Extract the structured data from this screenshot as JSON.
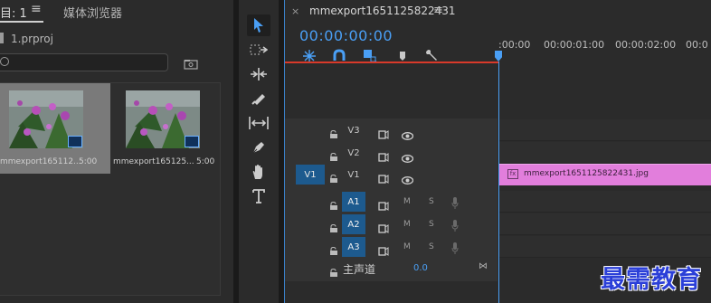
{
  "project_panel": {
    "tab_label": "目: 1",
    "tab_menu": "≡",
    "media_tab_label": "媒体浏览器",
    "path": "1.prproj",
    "clips": [
      {
        "name": "mmexport165112...",
        "duration": "5:00"
      },
      {
        "name": "mmexport165125...",
        "duration": "5:00"
      }
    ]
  },
  "timeline": {
    "close": "×",
    "title": "mmexport1651125822431",
    "menu": "≡",
    "timecode": "00:00:00:00",
    "ruler_labels": [
      ":00:00",
      "00:00:01:00",
      "00:00:02:00",
      "00:0"
    ],
    "video_tracks": [
      {
        "name": "V3"
      },
      {
        "name": "V2"
      },
      {
        "name": "V1",
        "target": "V1"
      }
    ],
    "audio_tracks": [
      {
        "name": "A1",
        "m": "M",
        "s": "S"
      },
      {
        "name": "A2",
        "m": "M",
        "s": "S"
      },
      {
        "name": "A3",
        "m": "M",
        "s": "S"
      }
    ],
    "master": {
      "label": "主声道",
      "value": "0.0",
      "end_icon": "⋈"
    },
    "clip": {
      "fx": "fx",
      "label": "mmexport1651125822431.jpg"
    }
  },
  "watermark": "最需教育",
  "colors": {
    "accent": "#4a9ff5",
    "clip": "#e27edc",
    "target": "#1d5a8e",
    "ruler_line": "#d83a2a",
    "watermark": "#2b3fd8"
  },
  "tools": [
    "selection-tool-icon",
    "track-select-icon",
    "ripple-edit-icon",
    "razor-icon",
    "slip-icon",
    "pen-icon",
    "hand-icon",
    "type-icon"
  ]
}
